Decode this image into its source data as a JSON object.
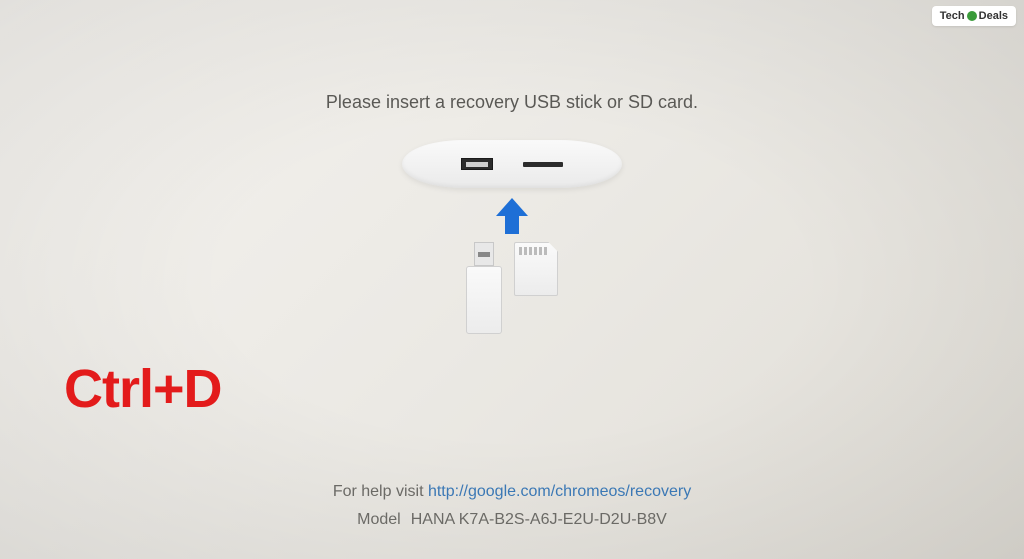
{
  "heading": "Please insert a recovery USB stick or SD card.",
  "shortcut_overlay": "Ctrl+D",
  "help": {
    "prefix": "For help visit ",
    "url_text": "http://google.com/chromeos/recovery"
  },
  "model": {
    "label": "Model",
    "value": "HANA K7A-B2S-A6J-E2U-D2U-B8V"
  },
  "watermark": {
    "left": "Tech",
    "right": "Deals"
  },
  "icons": {
    "arrow": "arrow-up-icon",
    "usb_port": "usb-port-icon",
    "sd_slot": "sd-slot-icon",
    "usb_stick": "usb-stick-icon",
    "sd_card": "sd-card-icon"
  },
  "colors": {
    "accent_red": "#e31b1b",
    "link_blue": "#3b78b5",
    "arrow_blue": "#1e6fd6"
  }
}
